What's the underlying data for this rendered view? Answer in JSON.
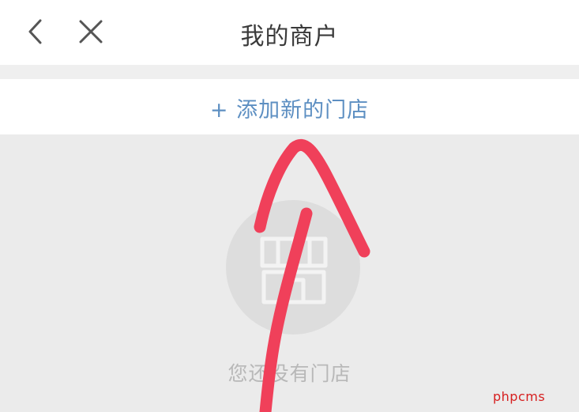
{
  "header": {
    "title": "我的商户",
    "back_icon": "chevron-left-icon",
    "close_icon": "close-icon"
  },
  "add_store": {
    "label": "+ 添加新的门店",
    "color": "#5d8fc2"
  },
  "empty_state": {
    "icon": "store-icon",
    "message": "您还没有门店"
  },
  "annotation": {
    "icon": "red-arrow-icon",
    "color": "#f0405a"
  },
  "watermark": {
    "text": "phpcms",
    "color": "#d61f1f"
  }
}
